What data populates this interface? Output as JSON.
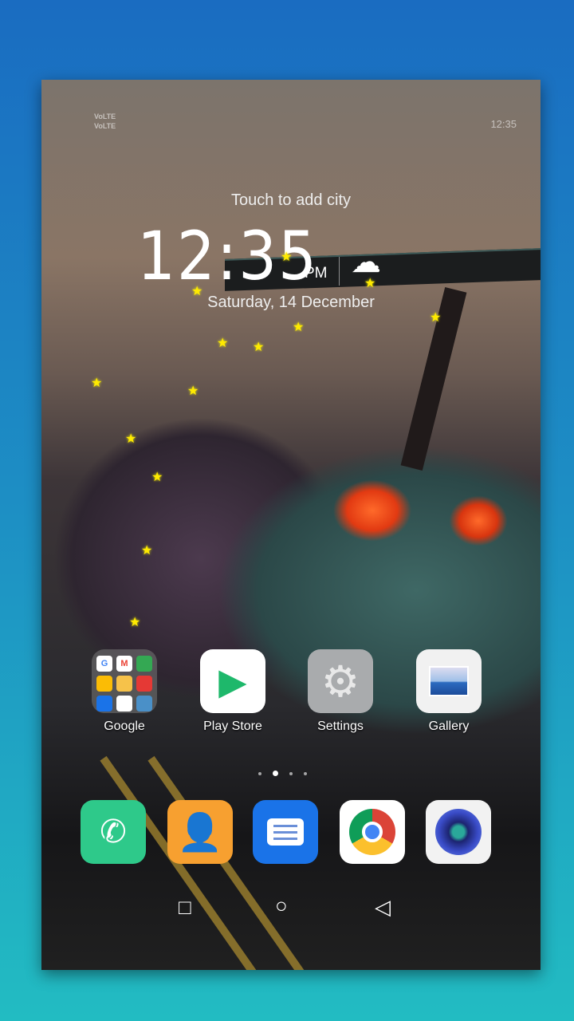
{
  "status": {
    "sim1": "VoLTE",
    "sim2": "VoLTE",
    "time": "12:35"
  },
  "lockwidget": {
    "city_prompt": "Touch to add city",
    "time": "12:35",
    "ampm": "PM",
    "date": "Saturday, 14 December",
    "weather_icon": "partly-cloudy-icon"
  },
  "apps": [
    {
      "label": "Google",
      "icon": "google-folder-icon"
    },
    {
      "label": "Play Store",
      "icon": "play-store-icon"
    },
    {
      "label": "Settings",
      "icon": "gear-icon"
    },
    {
      "label": "Gallery",
      "icon": "gallery-icon"
    }
  ],
  "folder_apps": [
    "G",
    "M",
    "Maps",
    "Drive",
    "Play",
    "YT",
    "Duo",
    "Photos",
    "Docs"
  ],
  "page_indicator": {
    "pages": 4,
    "current": 2
  },
  "dock": [
    {
      "name": "phone",
      "icon": "phone-icon",
      "color": "#2ec98a"
    },
    {
      "name": "contacts",
      "icon": "contacts-icon",
      "color": "#f7a030"
    },
    {
      "name": "messages",
      "icon": "messages-icon",
      "color": "#1a73e8"
    },
    {
      "name": "chrome",
      "icon": "chrome-icon",
      "color": "#ffffff"
    },
    {
      "name": "camera",
      "icon": "camera-icon",
      "color": "#f2f2f2"
    }
  ],
  "nav": {
    "recents": "recents-icon",
    "home": "home-icon",
    "back": "back-icon"
  }
}
